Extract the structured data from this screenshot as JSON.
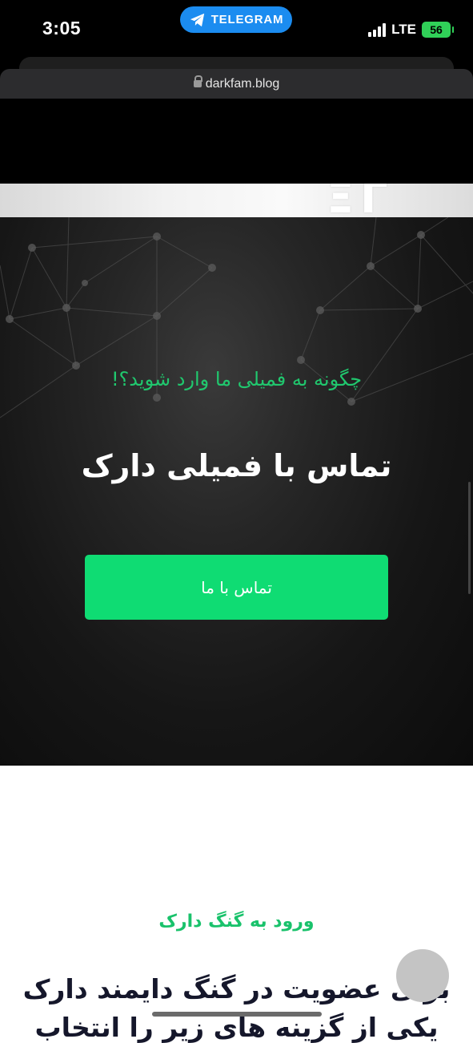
{
  "status_bar": {
    "time": "3:05",
    "back_app_label": "TELEGRAM",
    "network": "LTE",
    "battery": "56"
  },
  "browser": {
    "url": "darkfam.blog"
  },
  "hero": {
    "subtitle": "چگونه به فمیلی ما وارد شوید؟!",
    "title": "تماس با فمیلی دارک",
    "cta_label": "تماس با ما"
  },
  "section": {
    "label": "ورود به گنگ دارک",
    "heading_line1": "برای عضویت در گنگ دایمند دارک",
    "heading_line2": "یکی از گزینه های زیر را انتخاب"
  },
  "colors": {
    "accent_green": "#0fdc73",
    "telegram_blue": "#1b8cf0"
  }
}
